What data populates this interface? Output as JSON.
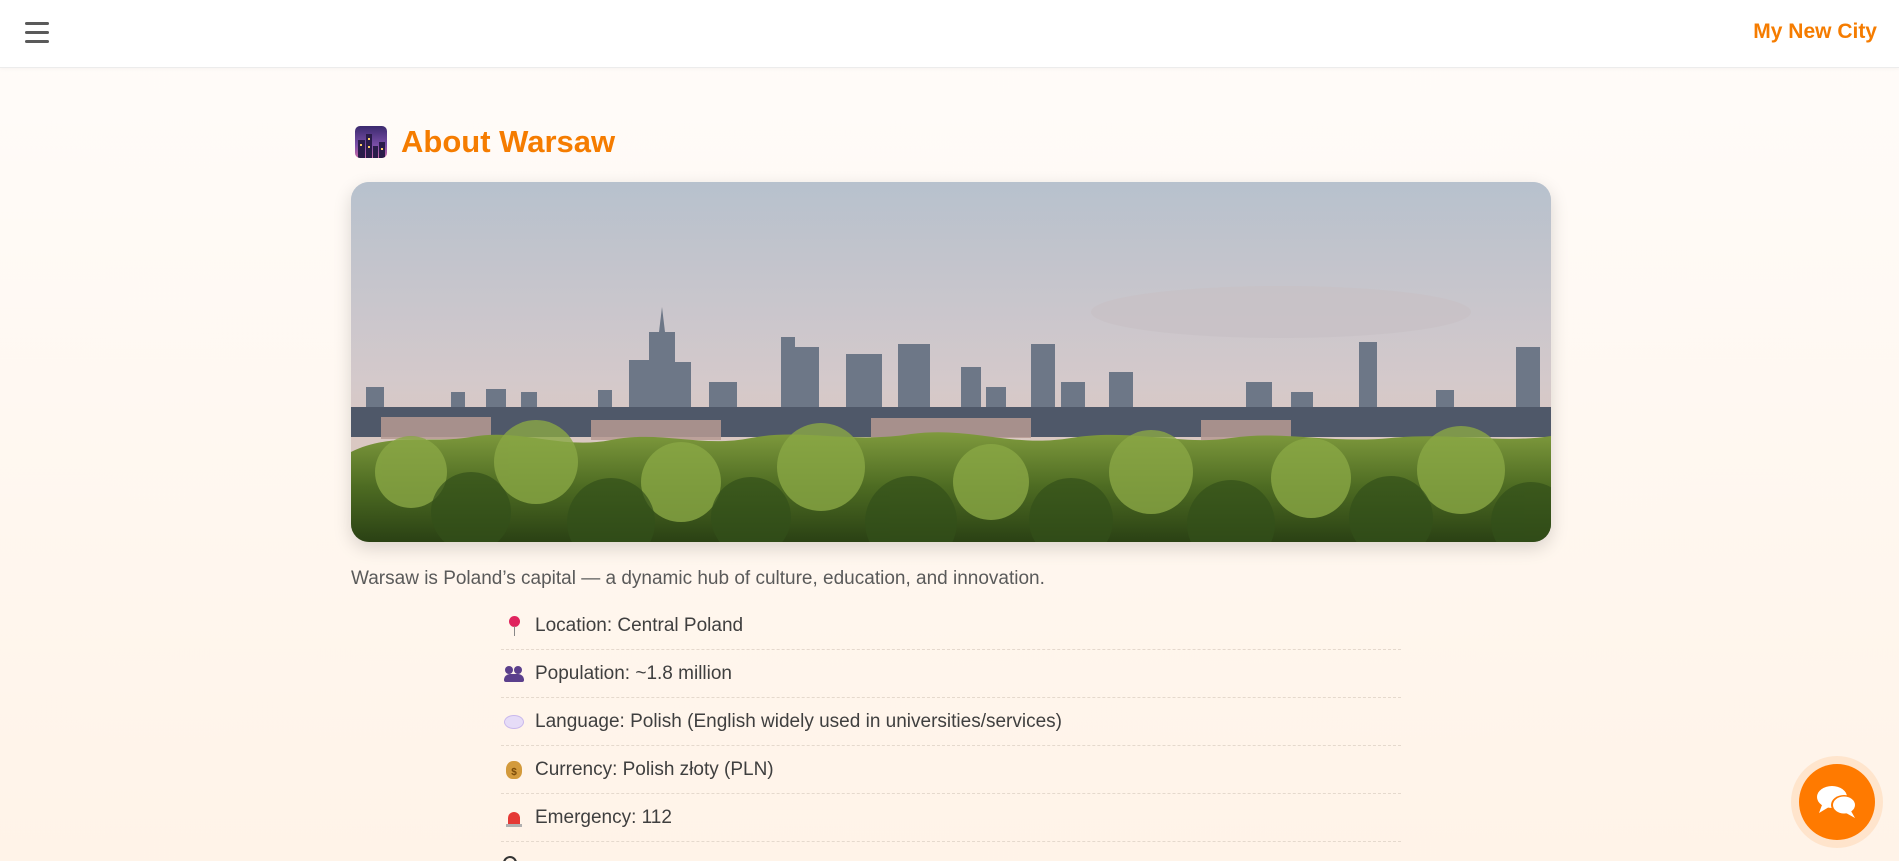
{
  "header": {
    "menu_icon": "hamburger-menu-icon",
    "brand": "My New City",
    "brand_color": "#f57c00"
  },
  "main": {
    "title": "About Warsaw",
    "title_icon": "night-city-icon",
    "hero_image_alt": "Warsaw skyline",
    "intro": "Warsaw is Poland’s capital — a dynamic hub of culture, education, and innovation.",
    "facts": [
      {
        "icon": "round-pushpin-icon",
        "text": "Location: Central Poland"
      },
      {
        "icon": "people-icon",
        "text": "Population: ~1.8 million"
      },
      {
        "icon": "speech-bubble-icon",
        "text": "Language: Polish (English widely used in universities/services)"
      },
      {
        "icon": "money-bag-icon",
        "text": "Currency: Polish złoty (PLN)"
      },
      {
        "icon": "siren-icon",
        "text": "Emergency: 112"
      }
    ]
  },
  "chat": {
    "icon": "chat-bubbles-icon",
    "accent": "#ff7a00"
  }
}
